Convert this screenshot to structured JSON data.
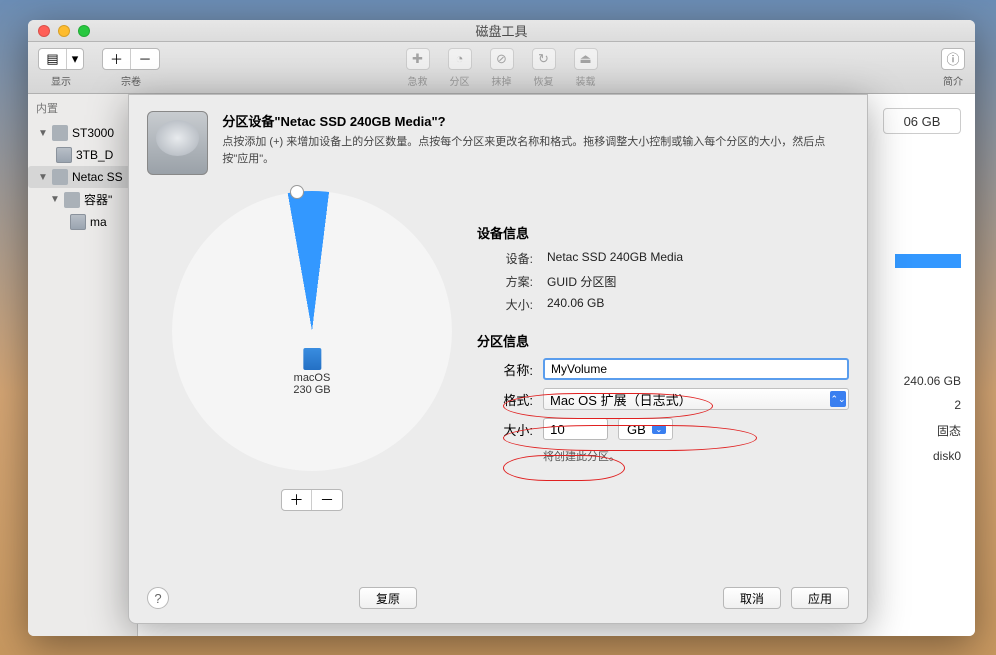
{
  "window": {
    "title": "磁盘工具"
  },
  "toolbar": {
    "view_label": "显示",
    "volume_label": "宗卷",
    "center": [
      {
        "label": "急救"
      },
      {
        "label": "分区"
      },
      {
        "label": "抹掉"
      },
      {
        "label": "恢复"
      },
      {
        "label": "装载"
      }
    ],
    "info_label": "简介"
  },
  "sidebar": {
    "header": "内置",
    "items": [
      {
        "label": "ST3000"
      },
      {
        "label": "3TB_D"
      },
      {
        "label": "Netac SS"
      },
      {
        "label": "容器\""
      },
      {
        "label": "ma"
      }
    ]
  },
  "main_bg": {
    "size_display": "06 GB",
    "rows": [
      {
        "v": "240.06 GB"
      },
      {
        "v": "2"
      },
      {
        "v": "固态"
      },
      {
        "v": "disk0"
      }
    ]
  },
  "sheet": {
    "title": "分区设备\"Netac SSD 240GB Media\"?",
    "subtitle": "点按添加 (+) 来增加设备上的分区数量。点按每个分区来更改名称和格式。拖移调整大小控制或输入每个分区的大小，然后点按\"应用\"。",
    "pie": {
      "name": "macOS",
      "size": "230 GB"
    },
    "device_header": "设备信息",
    "device_label": "设备:",
    "device_value": "Netac SSD 240GB Media",
    "scheme_label": "方案:",
    "scheme_value": "GUID 分区图",
    "size_label": "大小:",
    "size_value": "240.06 GB",
    "partition_header": "分区信息",
    "name_label": "名称:",
    "name_value": "MyVolume",
    "format_label": "格式:",
    "format_value": "Mac OS 扩展（日志式）",
    "psize_label": "大小:",
    "psize_value": "10",
    "unit": "GB",
    "hint": "将创建此分区。",
    "add": "＋",
    "remove": "－",
    "restore": "复原",
    "cancel": "取消",
    "apply": "应用"
  },
  "chart_data": {
    "type": "pie",
    "title": "",
    "series": [
      {
        "name": "MyVolume",
        "value": 10,
        "unit": "GB",
        "color": "#3398ff"
      },
      {
        "name": "macOS",
        "value": 230,
        "unit": "GB",
        "color": "#f5f5f5"
      }
    ],
    "total": 240.06
  }
}
